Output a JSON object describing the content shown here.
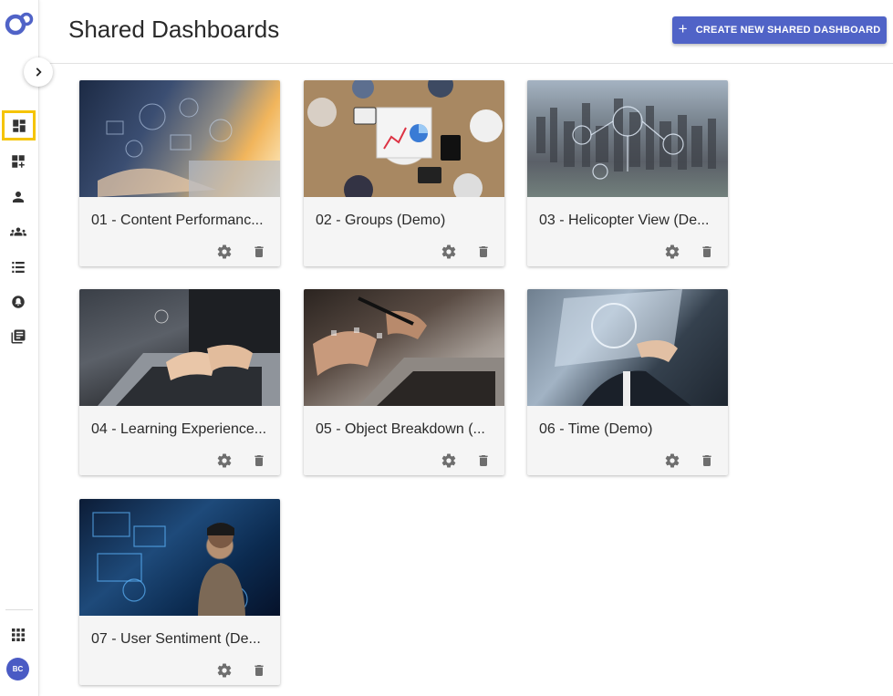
{
  "colors": {
    "accent": "#5063c7",
    "active_highlight": "#f5c400",
    "avatar_bg": "#4a5bc4",
    "icon_grey": "#6e6e6e"
  },
  "header": {
    "title": "Shared Dashboards",
    "create_button": "CREATE NEW SHARED DASHBOARD",
    "create_button_icon": "plus-icon"
  },
  "sidebar": {
    "logo_icon": "app-logo-icon",
    "expand_icon": "chevron-right-icon",
    "items": [
      {
        "icon": "dashboard-icon",
        "active": true
      },
      {
        "icon": "add-dashboard-icon",
        "active": false
      },
      {
        "icon": "person-icon",
        "active": false
      },
      {
        "icon": "group-icon",
        "active": false
      },
      {
        "icon": "list-icon",
        "active": false
      },
      {
        "icon": "notification-icon",
        "active": false
      },
      {
        "icon": "library-icon",
        "active": false
      }
    ],
    "apps_icon": "apps-grid-icon",
    "avatar_initials": "BC"
  },
  "cards": [
    {
      "title": "01 - Content Performanc...",
      "image": "business-laptop-image"
    },
    {
      "title": "02 - Groups (Demo)",
      "image": "meeting-table-image"
    },
    {
      "title": "03 - Helicopter View (De...",
      "image": "city-aerial-image"
    },
    {
      "title": "04 - Learning Experience...",
      "image": "typing-laptop-image"
    },
    {
      "title": "05 - Object Breakdown (...",
      "image": "pen-laptop-image"
    },
    {
      "title": "06 - Time (Demo)",
      "image": "touch-screen-image"
    },
    {
      "title": "07 - User Sentiment (De...",
      "image": "vr-woman-image"
    }
  ],
  "card_actions": {
    "settings_icon": "gear-icon",
    "delete_icon": "trash-icon"
  }
}
